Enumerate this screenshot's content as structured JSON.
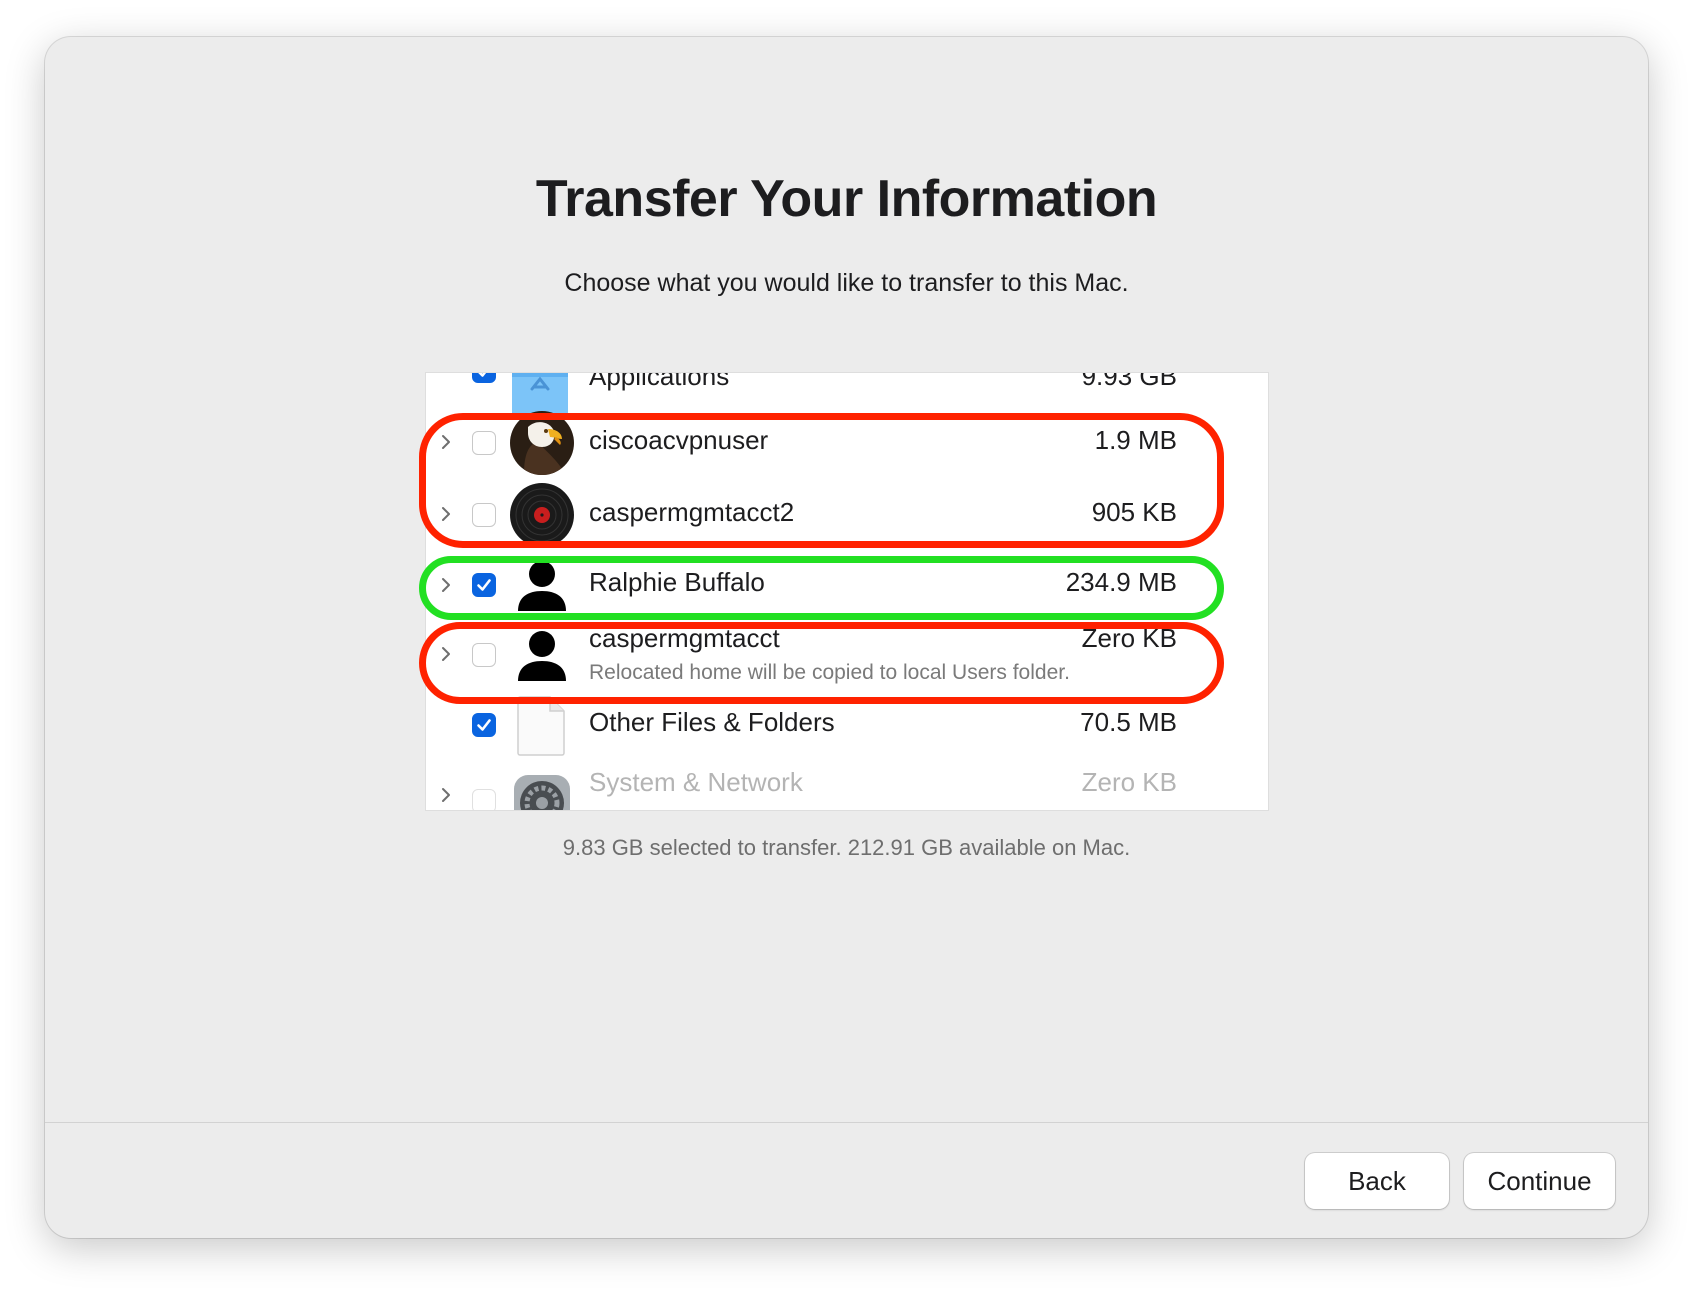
{
  "header": {
    "title": "Transfer Your Information",
    "subtitle": "Choose what you would like to transfer to this Mac."
  },
  "items": [
    {
      "label": "Applications",
      "size": "9.93 GB",
      "checked": true,
      "expandable": false,
      "icon": "applications-folder-icon"
    },
    {
      "label": "ciscoacvpnuser",
      "size": "1.9 MB",
      "checked": false,
      "expandable": true,
      "icon": "eagle-avatar-icon"
    },
    {
      "label": "caspermgmtacct2",
      "size": "905 KB",
      "checked": false,
      "expandable": true,
      "icon": "vinyl-record-avatar-icon"
    },
    {
      "label": "Ralphie Buffalo",
      "size": "234.9 MB",
      "checked": true,
      "expandable": true,
      "icon": "user-silhouette-icon"
    },
    {
      "label": "caspermgmtacct",
      "size": "Zero KB",
      "checked": false,
      "expandable": true,
      "icon": "user-silhouette-icon",
      "note": "Relocated home will be copied to local Users folder."
    },
    {
      "label": "Other Files & Folders",
      "size": "70.5 MB",
      "checked": true,
      "expandable": false,
      "icon": "document-icon"
    },
    {
      "label": "System & Network",
      "size": "Zero KB",
      "checked": false,
      "expandable": true,
      "disabled": true,
      "icon": "system-preferences-gear-icon"
    }
  ],
  "summary": "9.83 GB selected to transfer. 212.91 GB available on Mac.",
  "buttons": {
    "back": "Back",
    "continue": "Continue"
  },
  "colors": {
    "checkbox_checked": "#0a64e0",
    "highlight_red": "#ff2200",
    "highlight_green": "#22e022"
  }
}
